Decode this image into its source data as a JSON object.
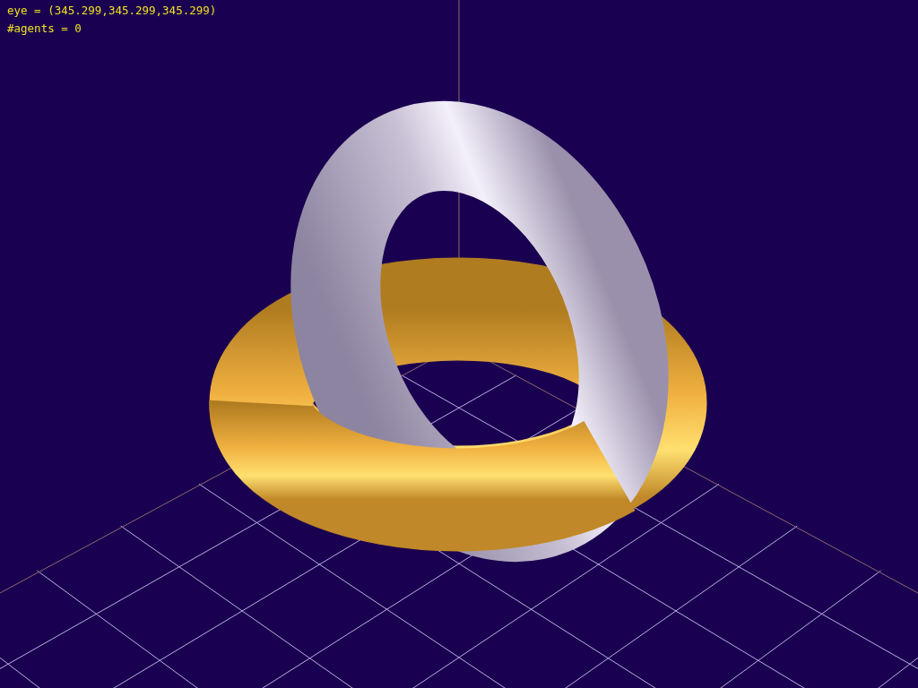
{
  "overlay": {
    "lines": [
      "eye = (345.299,345.299,345.299)",
      "#agents = 0"
    ]
  }
}
